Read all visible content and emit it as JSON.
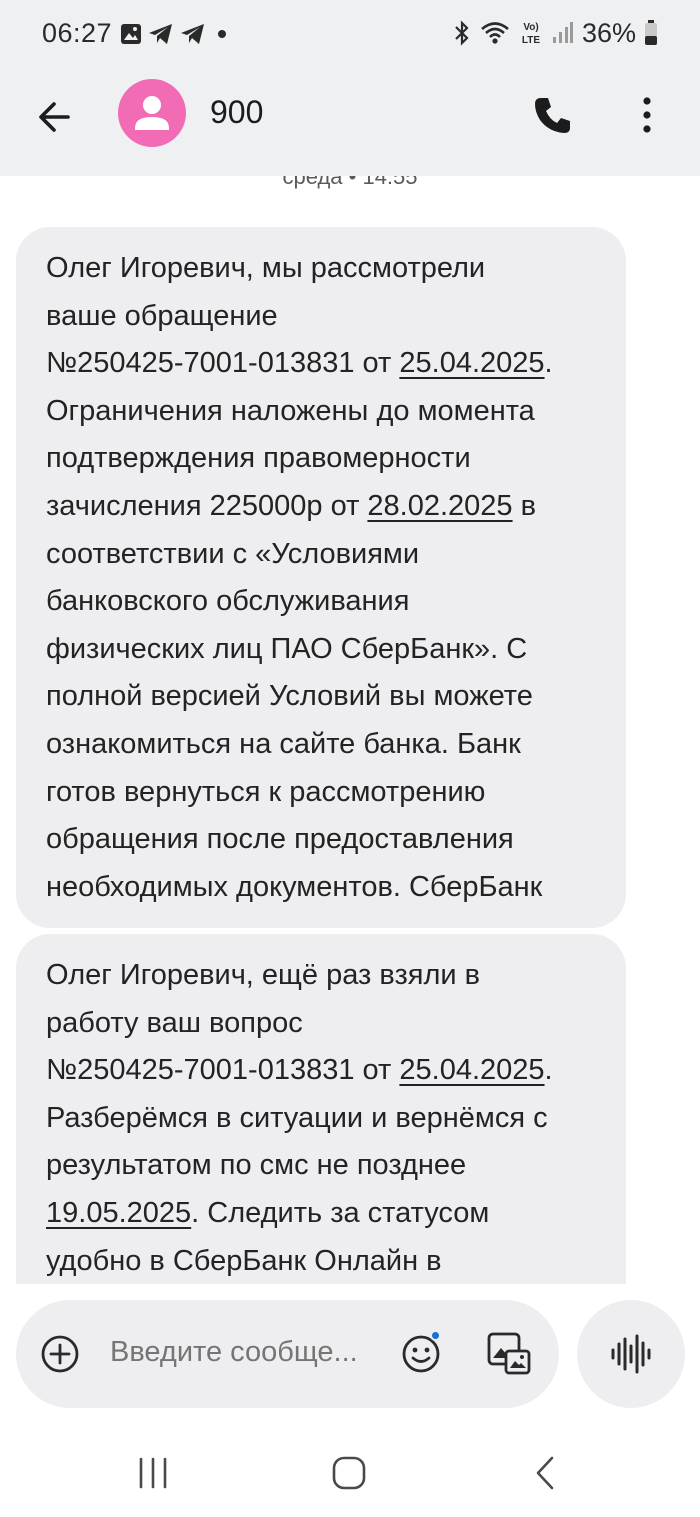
{
  "status_bar": {
    "time": "06:27",
    "battery": "36%",
    "icons": [
      "image-icon",
      "telegram-icon",
      "telegram-icon",
      "bluetooth-icon",
      "wifi-icon",
      "volte-lte-icon",
      "signal-icon",
      "battery-icon"
    ]
  },
  "header": {
    "contact_name": "900",
    "avatar_color": "#f26bb5"
  },
  "conversation": {
    "date_separator": "среда • 14:55",
    "messages": [
      {
        "lines": [
          [
            {
              "t": "Олег Игоревич, мы рассмотрели"
            }
          ],
          [
            {
              "t": "ваше обращение"
            }
          ],
          [
            {
              "t": "№250425-7001-013831 от "
            },
            {
              "t": "25.04.2025",
              "u": true
            },
            {
              "t": "."
            }
          ],
          [
            {
              "t": "Ограничения наложены до момента"
            }
          ],
          [
            {
              "t": "подтверждения правомерности"
            }
          ],
          [
            {
              "t": "зачисления 225000р от "
            },
            {
              "t": "28.02.2025",
              "u": true
            },
            {
              "t": " в"
            }
          ],
          [
            {
              "t": "соответствии с «Условиями"
            }
          ],
          [
            {
              "t": "банковского обслуживания"
            }
          ],
          [
            {
              "t": "физических лиц ПАО СберБанк». С"
            }
          ],
          [
            {
              "t": "полной версией Условий вы можете"
            }
          ],
          [
            {
              "t": "ознакомиться на сайте банка. Банк"
            }
          ],
          [
            {
              "t": "готов вернуться к рассмотрению"
            }
          ],
          [
            {
              "t": "обращения после предоставления"
            }
          ],
          [
            {
              "t": "необходимых документов. СберБанк"
            }
          ]
        ]
      },
      {
        "lines": [
          [
            {
              "t": "Олег Игоревич, ещё раз взяли в"
            }
          ],
          [
            {
              "t": "работу ваш вопрос"
            }
          ],
          [
            {
              "t": "№250425-7001-013831 от "
            },
            {
              "t": "25.04.2025",
              "u": true
            },
            {
              "t": "."
            }
          ],
          [
            {
              "t": "Разберёмся в ситуации и вернёмся с"
            }
          ],
          [
            {
              "t": "результатом по смс не позднее"
            }
          ],
          [
            {
              "t": "19.05.2025",
              "u": true
            },
            {
              "t": ". Следить за статусом"
            }
          ],
          [
            {
              "t": "удобно в СберБанк Онлайн в"
            }
          ]
        ]
      }
    ]
  },
  "composer": {
    "placeholder": "Введите сообще...",
    "badge_color": "#1a6fd1"
  }
}
